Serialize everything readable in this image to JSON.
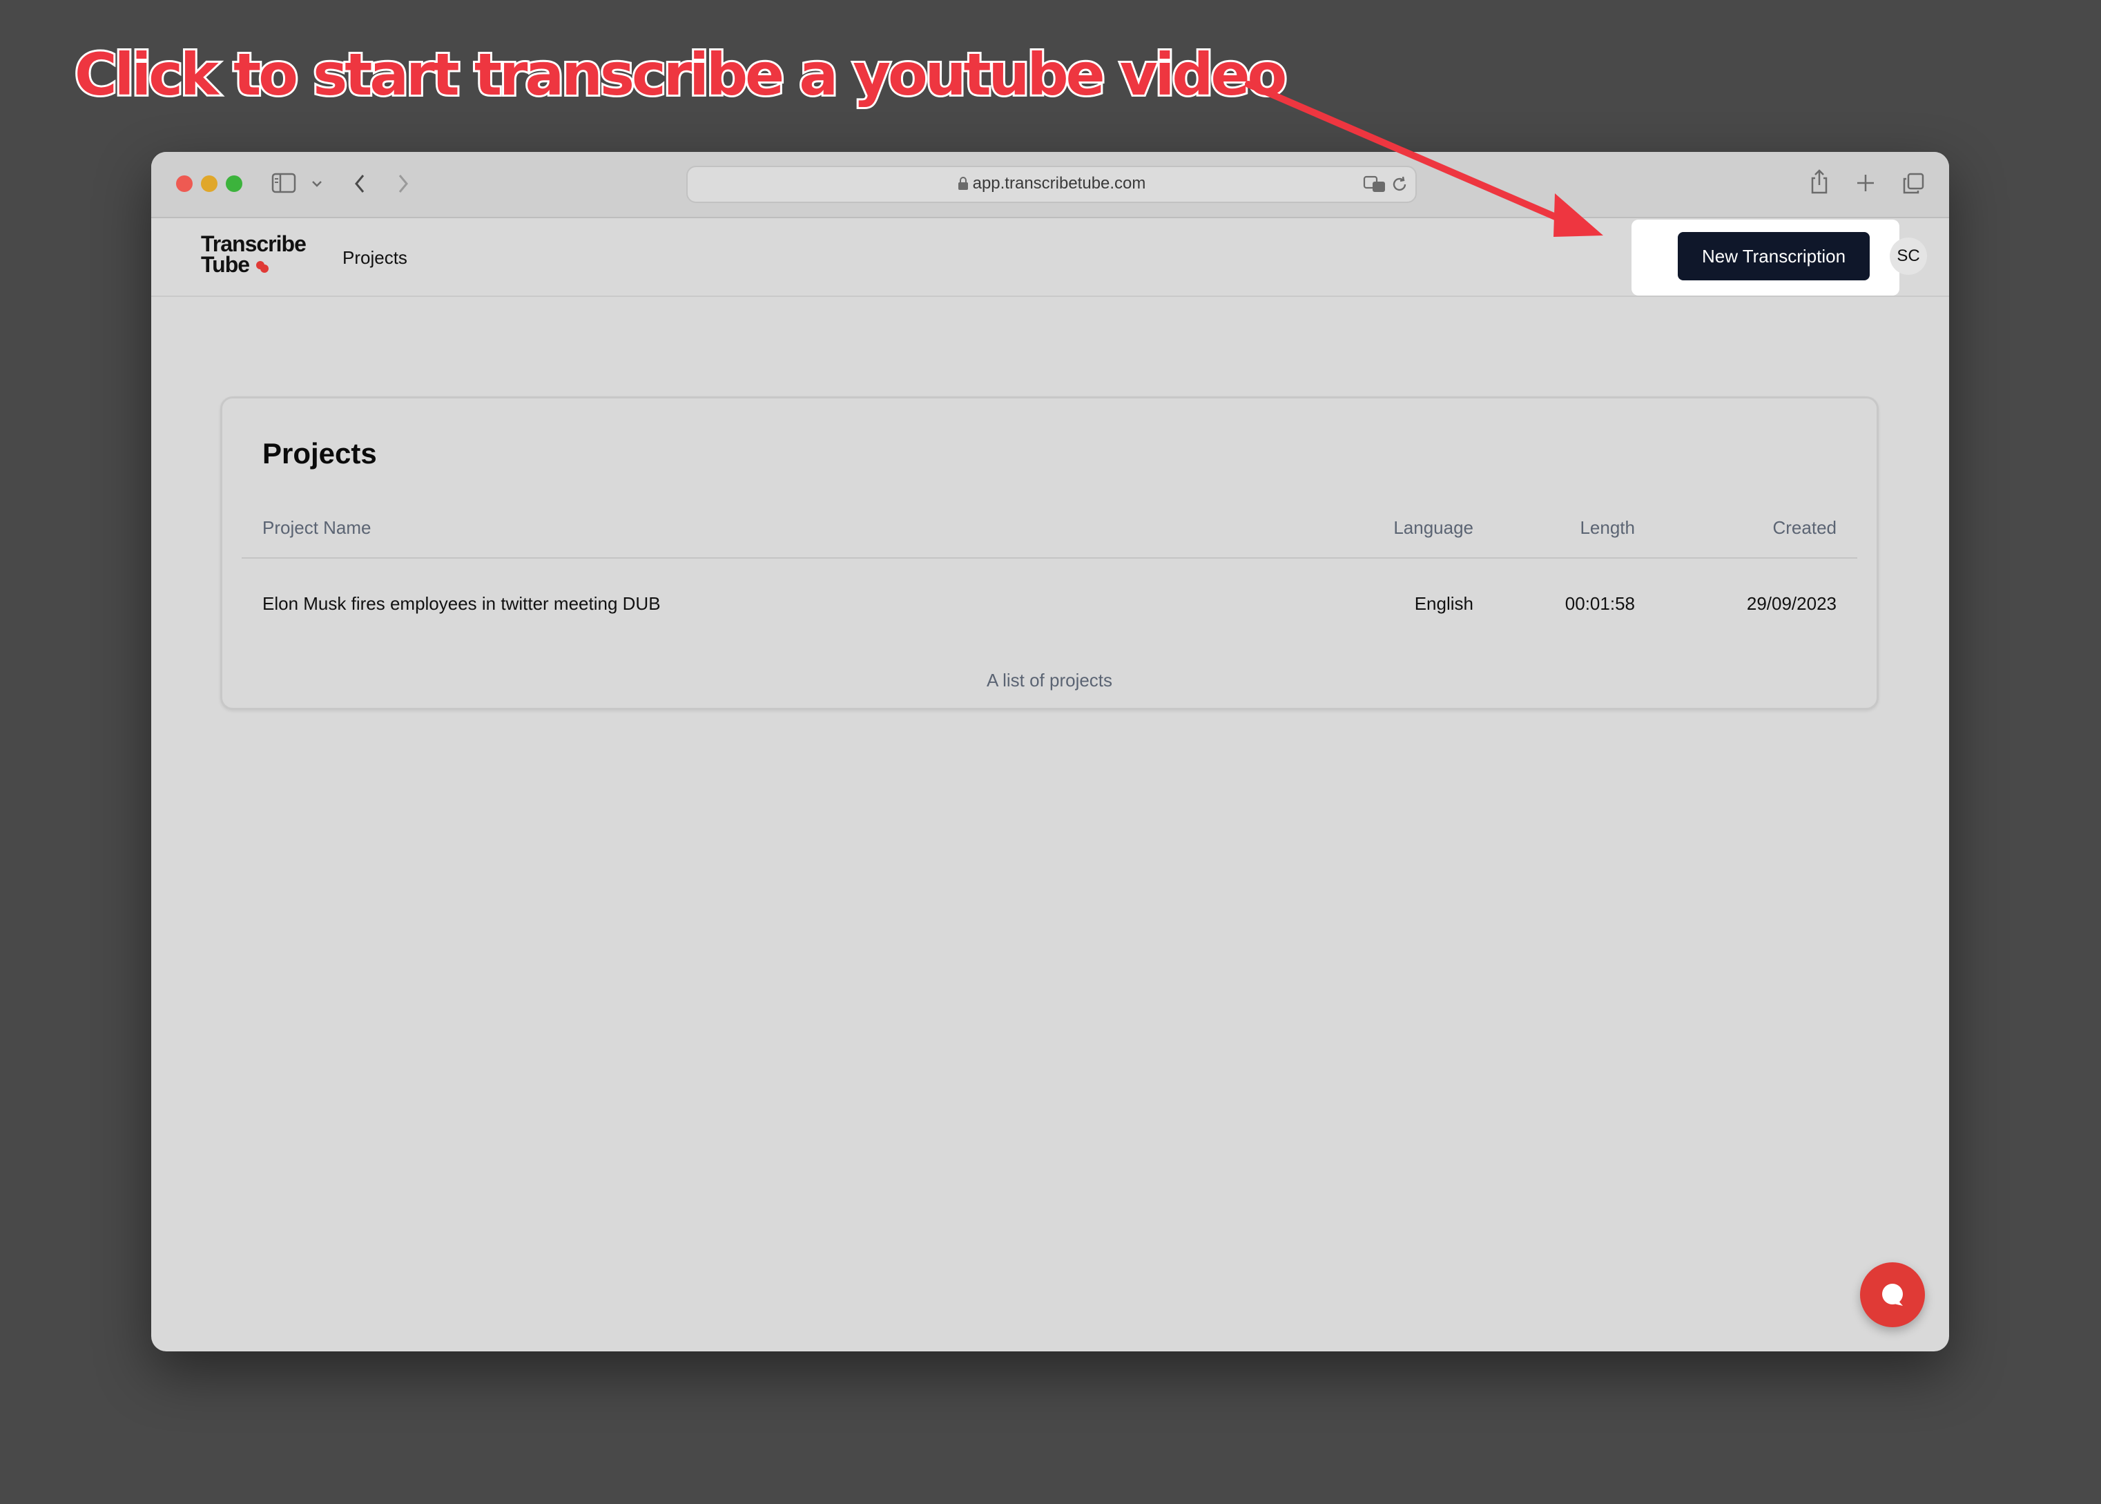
{
  "annotation": {
    "text": "Click  to start transcribe a youtube video",
    "color": "#ee3640"
  },
  "browser": {
    "url": "app.transcribetube.com"
  },
  "app": {
    "logo_line1": "Transcribe",
    "logo_line2": "Tube",
    "nav_projects": "Projects",
    "new_transcription_label": "New Transcription",
    "avatar_initials": "SC",
    "accent_color": "#0f172a",
    "brand_color": "#e03a36"
  },
  "projects": {
    "title": "Projects",
    "columns": [
      "Project Name",
      "Language",
      "Length",
      "Created"
    ],
    "rows": [
      {
        "name": "Elon Musk fires employees in twitter meeting DUB",
        "language": "English",
        "length": "00:01:58",
        "created": "29/09/2023"
      }
    ],
    "caption": "A list of projects"
  },
  "icons": [
    "close-dot",
    "minimize-dot",
    "zoom-dot",
    "sidebar-icon",
    "chevron-down-icon",
    "back-icon",
    "forward-icon",
    "lock-icon",
    "translate-icon",
    "reload-icon",
    "share-icon",
    "plus-icon",
    "tabs-icon",
    "chat-icon"
  ]
}
